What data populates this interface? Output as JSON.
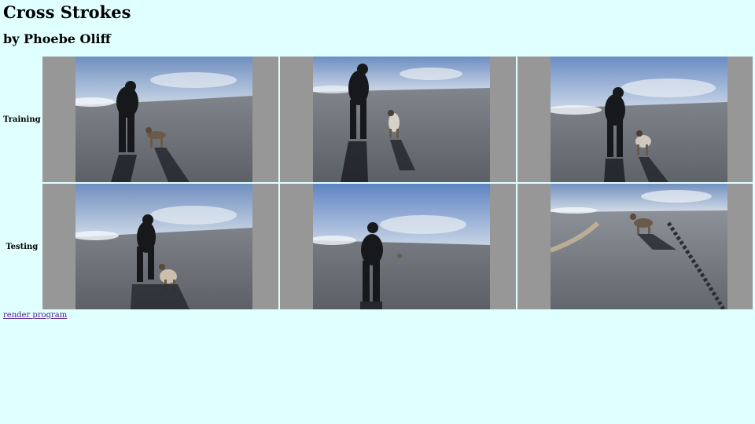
{
  "title": "Cross Strokes",
  "byline": "by Phoebe Oliff",
  "rows": [
    {
      "label": "Training"
    },
    {
      "label": "Testing"
    }
  ],
  "link": "render program"
}
